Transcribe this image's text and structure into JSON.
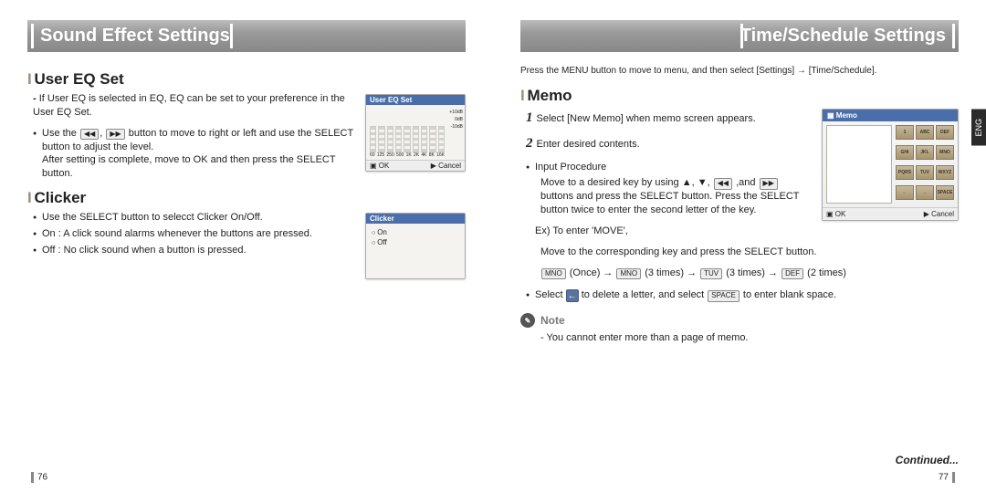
{
  "left": {
    "header": "Sound Effect Settings",
    "userEq": {
      "title": "User EQ Set",
      "intro": "If User EQ is selected in EQ, EQ can be set to your preference in the User EQ Set.",
      "b1a": "Use the ",
      "b1b": " button to move to right or left and use the SELECT button to adjust the level.",
      "b1c": "After setting is complete, move to OK and then press the SELECT button.",
      "screenTitle": "User EQ Set",
      "freqs": [
        "60",
        "125",
        "250",
        "500",
        "1K",
        "2K",
        "4K",
        "8K",
        "16K"
      ],
      "db": [
        "+10dB",
        "0dB",
        "-10dB"
      ],
      "ok": "OK",
      "cancel": "Cancel"
    },
    "clicker": {
      "title": "Clicker",
      "b1": "Use the SELECT button to selecct Clicker On/Off.",
      "b2": "On : A click sound alarms whenever the buttons are pressed.",
      "b3": "Off : No click sound when a button is pressed.",
      "screenTitle": "Clicker",
      "opt1": "On",
      "opt2": "Off"
    },
    "pageNum": "76"
  },
  "right": {
    "header": "Time/Schedule Settings",
    "topText": "Press the MENU button to move to menu, and then select [Settings] → [Time/Schedule].",
    "memo": {
      "title": "Memo",
      "step1": "Select [New Memo] when memo screen appears.",
      "step2": "Enter desired contents.",
      "inputProc": "Input Procedure",
      "ip1": "Move to a desired key by using ▲, ▼, ",
      "ip1b": " ,and ",
      "ip1c": " buttons and press the SELECT button. Press the SELECT button twice to enter the second letter of the key.",
      "ex": "Ex) To enter 'MOVE',",
      "ex1": "Move to the corresponding key and press the SELECT button.",
      "seq": {
        "p1": "MNO",
        "t1": "(Once)",
        "arrow": "→",
        "p2": "MNO",
        "t2": "(3 times)",
        "p3": "TUV",
        "t3": "(3 times)",
        "p4": "DEF",
        "t4": "(2 times)"
      },
      "delSelect": "Select ",
      "delMid": " to delete a letter, and select ",
      "delEnd": " to enter blank space.",
      "spaceKey": "SPACE",
      "noteLabel": "Note",
      "noteText": "You cannot enter more than a page of memo.",
      "screenTitle": "Memo",
      "keys": [
        "ABC",
        "DEF",
        "GHI",
        "JKL",
        "MNO",
        "PQRS",
        "TUV",
        "WXYZ",
        "←",
        ".",
        "SPACE"
      ],
      "keysRow": [
        [
          "1",
          "ABC",
          "DEF"
        ],
        [
          "GHI",
          "JKL",
          "MNO"
        ],
        [
          "PQRS",
          "TUV",
          "WXYZ"
        ],
        [
          "←",
          ".",
          "SPACE"
        ]
      ],
      "ok": "OK",
      "cancel": "Cancel"
    },
    "continued": "Continued...",
    "pageNum": "77",
    "lang": "ENG"
  }
}
